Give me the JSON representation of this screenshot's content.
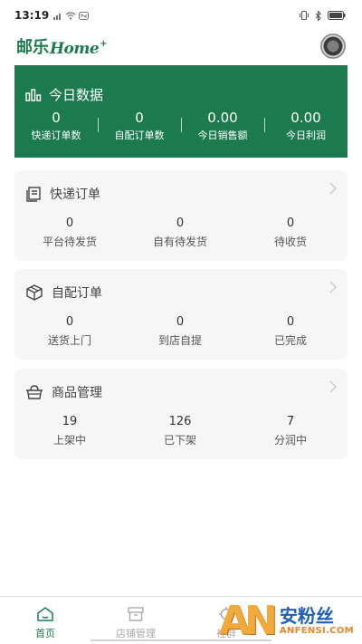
{
  "status_bar": {
    "time": "13:19"
  },
  "header": {
    "logo_cn": "邮乐",
    "logo_en": "Home",
    "logo_plus": "+"
  },
  "today_stats": {
    "title": "今日数据",
    "items": [
      {
        "value": "0",
        "label": "快递订单数"
      },
      {
        "value": "0",
        "label": "自配订单数"
      },
      {
        "value": "0.00",
        "label": "今日销售额"
      },
      {
        "value": "0.00",
        "label": "今日利润"
      }
    ]
  },
  "cards": [
    {
      "title": "快递订单",
      "icon": "express-order-icon",
      "metrics": [
        {
          "value": "0",
          "label": "平台待发货"
        },
        {
          "value": "0",
          "label": "自有待发货"
        },
        {
          "value": "0",
          "label": "待收货"
        }
      ]
    },
    {
      "title": "自配订单",
      "icon": "box-icon",
      "metrics": [
        {
          "value": "0",
          "label": "送货上门"
        },
        {
          "value": "0",
          "label": "到店自提"
        },
        {
          "value": "0",
          "label": "已完成"
        }
      ]
    },
    {
      "title": "商品管理",
      "icon": "basket-icon",
      "metrics": [
        {
          "value": "19",
          "label": "上架中"
        },
        {
          "value": "126",
          "label": "已下架"
        },
        {
          "value": "7",
          "label": "分润中"
        }
      ]
    }
  ],
  "bottom_nav": [
    {
      "label": "首页",
      "icon": "home-icon",
      "active": true
    },
    {
      "label": "店铺管理",
      "icon": "store-icon",
      "active": false
    },
    {
      "label": "社群",
      "icon": "community-icon",
      "active": false
    }
  ],
  "watermark": {
    "logo": "AN",
    "cn": "安粉丝",
    "en": "ANFENSI.COM"
  },
  "colors": {
    "primary": "#1b7a4e",
    "card_bg": "#f5f6f5",
    "nav_inactive": "#aaaaaa"
  }
}
